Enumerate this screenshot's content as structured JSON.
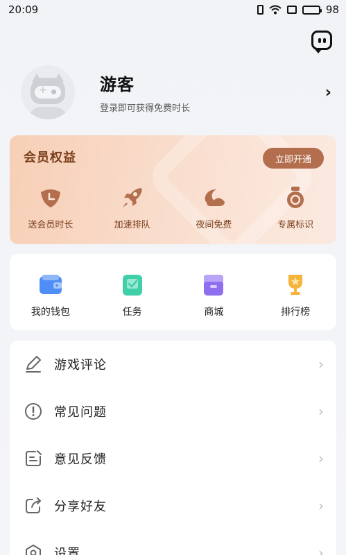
{
  "status_bar": {
    "time": "20:09",
    "battery": "98"
  },
  "profile": {
    "name": "游客",
    "subtitle": "登录即可获得免费时长",
    "arrow": "›"
  },
  "vip": {
    "title": "会员权益",
    "open_button": "立即开通",
    "items": [
      {
        "label": "送会员时长",
        "icon": "membership-time-icon"
      },
      {
        "label": "加速排队",
        "icon": "rocket-icon"
      },
      {
        "label": "夜间免费",
        "icon": "moon-icon"
      },
      {
        "label": "专属标识",
        "icon": "badge-icon"
      }
    ]
  },
  "features": [
    {
      "label": "我的钱包",
      "icon": "wallet-icon",
      "color": "#4f8ef7"
    },
    {
      "label": "任务",
      "icon": "task-icon",
      "color": "#3fcfa9"
    },
    {
      "label": "商城",
      "icon": "store-icon",
      "color": "#8f6ff0"
    },
    {
      "label": "排行榜",
      "icon": "trophy-icon",
      "color": "#f5b43c"
    }
  ],
  "menu": [
    {
      "label": "游戏评论",
      "icon": "edit-icon"
    },
    {
      "label": "常见问题",
      "icon": "exclamation-icon"
    },
    {
      "label": "意见反馈",
      "icon": "feedback-icon"
    },
    {
      "label": "分享好友",
      "icon": "share-icon"
    },
    {
      "label": "设置",
      "icon": "settings-icon"
    }
  ],
  "colors": {
    "vip_text": "#7a3e1c",
    "vip_button": "#b36e4d",
    "chevron": "#b9bcc2"
  }
}
